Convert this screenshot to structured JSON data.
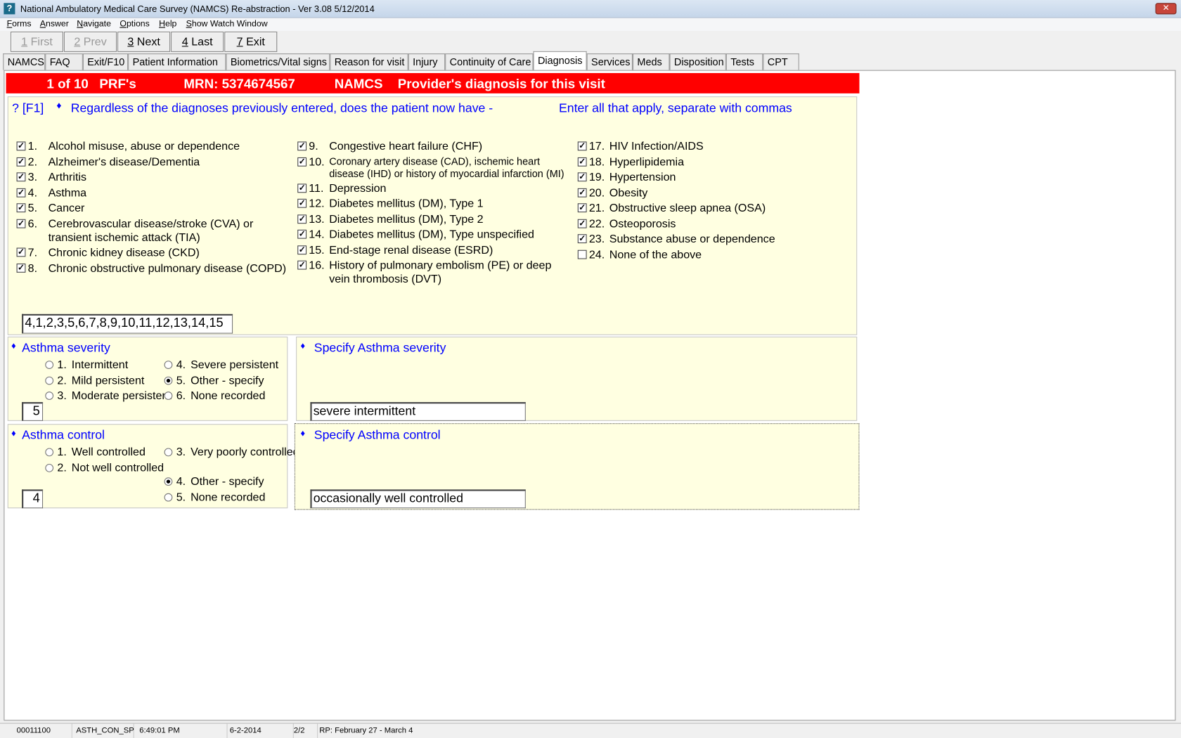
{
  "window": {
    "title": "National Ambulatory Medical Care Survey (NAMCS) Re-abstraction  - Ver 3.08 5/12/2014",
    "icon": "app-icon",
    "close": "✕"
  },
  "menu": [
    {
      "key": "F",
      "rest": "orms"
    },
    {
      "key": "A",
      "rest": "nswer"
    },
    {
      "key": "N",
      "rest": "avigate"
    },
    {
      "key": "O",
      "rest": "ptions"
    },
    {
      "key": "H",
      "rest": "elp"
    },
    {
      "key": "S",
      "rest": "how Watch Window"
    }
  ],
  "toolbar": [
    {
      "key": "1",
      "label": " First",
      "enabled": false
    },
    {
      "key": "2",
      "label": " Prev",
      "enabled": false
    },
    {
      "key": "3",
      "label": " Next",
      "enabled": true
    },
    {
      "key": "4",
      "label": " Last",
      "enabled": true
    },
    {
      "key": "7",
      "label": " Exit",
      "enabled": true
    }
  ],
  "tabs": [
    "NAMCS",
    "FAQ",
    "Exit/F10",
    "Patient Information",
    "Biometrics/Vital signs",
    "Reason for visit",
    "Injury",
    "Continuity of Care",
    "Diagnosis",
    "Services",
    "Meds",
    "Disposition",
    "Tests",
    "CPT"
  ],
  "active_tab": "Diagnosis",
  "header": {
    "record": "1 of 10",
    "prf": "PRF's",
    "mrn": "MRN: 5374674567",
    "survey": "NAMCS",
    "section": "Provider's diagnosis for this visit",
    "color": "#ff0000"
  },
  "question": {
    "help": "? [F1]",
    "bullet": "♦",
    "text": "Regardless of the diagnoses previously entered, does the patient now have -",
    "instruction": "Enter all that apply, separate with commas",
    "answer": "4,1,2,3,5,6,7,8,9,10,11,12,13,14,15"
  },
  "columns": [
    [
      {
        "num": "1.",
        "text": "Alcohol misuse, abuse or dependence",
        "checked": true
      },
      {
        "num": "2.",
        "text": "Alzheimer's disease/Dementia",
        "checked": true
      },
      {
        "num": "3.",
        "text": "Arthritis",
        "checked": true
      },
      {
        "num": "4.",
        "text": "Asthma",
        "checked": true
      },
      {
        "num": "5.",
        "text": "Cancer",
        "checked": true
      },
      {
        "num": "6.",
        "text": "Cerebrovascular disease/stroke (CVA) or transient ischemic attack (TIA)",
        "checked": true
      },
      {
        "num": "7.",
        "text": "Chronic kidney disease (CKD)",
        "checked": true
      },
      {
        "num": "8.",
        "text": "Chronic obstructive pulmonary disease (COPD)",
        "checked": true
      }
    ],
    [
      {
        "num": "9.",
        "text": "Congestive heart failure (CHF)",
        "checked": true
      },
      {
        "num": "10.",
        "text": "Coronary artery disease (CAD), ischemic heart disease (IHD) or history of myocardial infarction (MI)",
        "checked": true
      },
      {
        "num": "11.",
        "text": "Depression",
        "checked": true
      },
      {
        "num": "12.",
        "text": "Diabetes mellitus (DM), Type 1",
        "checked": true
      },
      {
        "num": "13.",
        "text": "Diabetes mellitus (DM), Type 2",
        "checked": true
      },
      {
        "num": "14.",
        "text": "Diabetes mellitus (DM), Type unspecified",
        "checked": true
      },
      {
        "num": "15.",
        "text": "End-stage renal disease (ESRD)",
        "checked": true
      },
      {
        "num": "16.",
        "text": "History of pulmonary embolism (PE) or deep vein thrombosis (DVT)",
        "checked": true
      }
    ],
    [
      {
        "num": "17.",
        "text": "HIV Infection/AIDS",
        "checked": true
      },
      {
        "num": "18.",
        "text": "Hyperlipidemia",
        "checked": true
      },
      {
        "num": "19.",
        "text": "Hypertension",
        "checked": true
      },
      {
        "num": "20.",
        "text": "Obesity",
        "checked": true
      },
      {
        "num": "21.",
        "text": "Obstructive sleep apnea (OSA)",
        "checked": true
      },
      {
        "num": "22.",
        "text": "Osteoporosis",
        "checked": true
      },
      {
        "num": "23.",
        "text": "Substance abuse or dependence",
        "checked": true
      },
      {
        "num": "24.",
        "text": "None of the above",
        "checked": false
      }
    ]
  ],
  "severity": {
    "title": "Asthma severity",
    "answer": "5",
    "options": [
      {
        "num": "1.",
        "text": "Intermittent",
        "selected": false
      },
      {
        "num": "2.",
        "text": "Mild persistent",
        "selected": false
      },
      {
        "num": "3.",
        "text": "Moderate persistent",
        "selected": false
      },
      {
        "num": "4.",
        "text": "Severe persistent",
        "selected": false
      },
      {
        "num": "5.",
        "text": "Other - specify",
        "selected": true
      },
      {
        "num": "6.",
        "text": "None recorded",
        "selected": false
      }
    ]
  },
  "severity_specify": {
    "title": "Specify Asthma severity",
    "value": "severe intermittent"
  },
  "control": {
    "title": "Asthma control",
    "answer": "4",
    "options": [
      {
        "num": "1.",
        "text": "Well controlled",
        "selected": false
      },
      {
        "num": "2.",
        "text": "Not well controlled",
        "selected": false
      },
      {
        "num": "3.",
        "text": "Very poorly controlled",
        "selected": false
      },
      {
        "num": "4.",
        "text": "Other - specify",
        "selected": true
      },
      {
        "num": "5.",
        "text": "None recorded",
        "selected": false
      }
    ]
  },
  "control_specify": {
    "title": "Specify Asthma control",
    "value": "occasionally well controlled"
  },
  "status": {
    "code": "00011100",
    "field": "ASTH_CON_SP",
    "time": "6:49:01 PM",
    "date": "6-2-2014",
    "page": "2/2",
    "period": "RP: February 27 - March 4"
  }
}
